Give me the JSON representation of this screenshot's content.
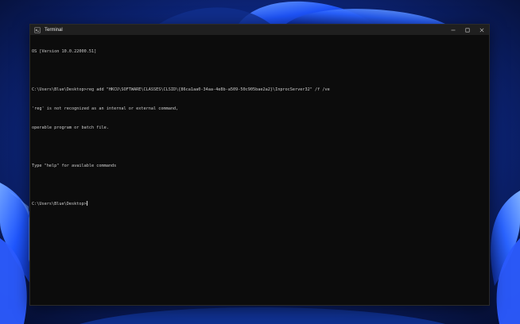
{
  "window": {
    "title": "Terminal"
  },
  "controls": {
    "minimize_glyph": "—",
    "maximize_glyph": "☐",
    "close_glyph": "✕"
  },
  "console": {
    "lines": [
      "OS [Version 10.0.22000.51]",
      "",
      "C:\\Users\\Blue\\Desktop>reg add \"HKCU\\SOFTWARE\\CLASSES\\CLSID\\{86ca1aa0-34aa-4e8b-a509-50c905bae2a2}\\InprocServer32\" /f /ve",
      "'reg' is not recognized as an internal or external command,",
      "operable program or batch file.",
      "",
      "Type \"help\" for available commands",
      ""
    ],
    "prompt": "C:\\Users\\Blue\\Desktop>"
  },
  "colors": {
    "terminal_bg": "#0c0c0c",
    "titlebar_bg": "#1f1f1f",
    "text": "#cccccc",
    "wallpaper_bg": "#0a1a4a",
    "wallpaper_bloom": "#1e5bff"
  },
  "icons": {
    "app": "terminal-icon",
    "minimize": "minimize-icon",
    "maximize": "maximize-icon",
    "close": "close-icon"
  }
}
